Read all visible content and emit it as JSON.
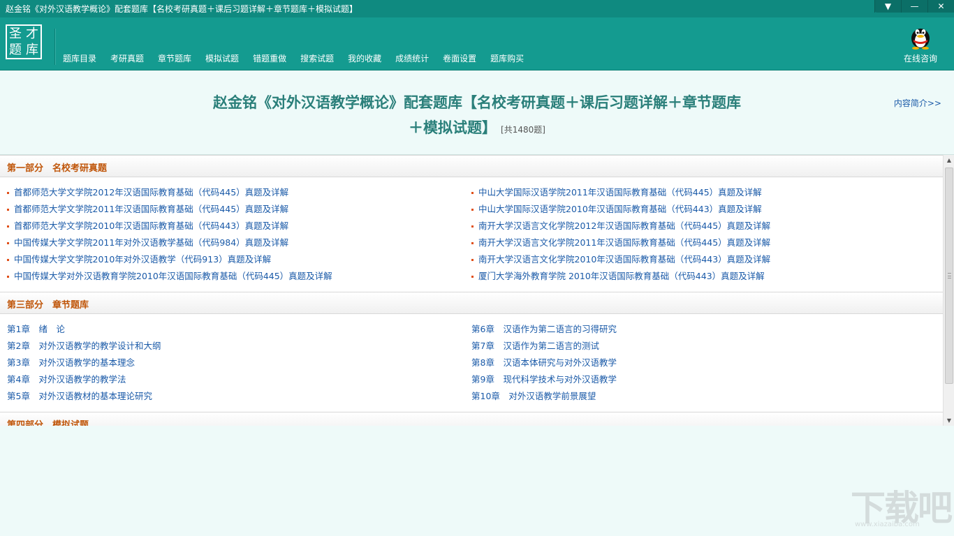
{
  "window": {
    "title": "赵金铭《对外汉语教学概论》配套题库【名校考研真题＋课后习题详解＋章节题库＋模拟试题】",
    "menu_glyph": "▼",
    "minimize_glyph": "—",
    "close_glyph": "✕"
  },
  "logo": {
    "chars": [
      "圣",
      "才",
      "题",
      "库"
    ]
  },
  "nav": [
    "题库目录",
    "考研真题",
    "章节题库",
    "模拟试题",
    "错题重做",
    "搜索试题",
    "我的收藏",
    "成绩统计",
    "卷面设置",
    "题库购买"
  ],
  "consult": {
    "label": "在线咨询"
  },
  "intro": {
    "title": "赵金铭《对外汉语教学概论》配套题库【名校考研真题＋课后习题详解＋章节题库＋模拟试题】",
    "count": "[共1480题]",
    "desc_link": "内容简介>>"
  },
  "sections": [
    {
      "title": "第一部分　名校考研真题",
      "left": [
        "首都师范大学文学院2012年汉语国际教育基础（代码445）真题及详解",
        "首都师范大学文学院2011年汉语国际教育基础（代码445）真题及详解",
        "首都师范大学文学院2010年汉语国际教育基础（代码443）真题及详解",
        "中国传媒大学文学院2011年对外汉语教学基础（代码984）真题及详解",
        "中国传媒大学文学院2010年对外汉语教学（代码913）真题及详解",
        "中国传媒大学对外汉语教育学院2010年汉语国际教育基础（代码445）真题及详解"
      ],
      "right": [
        "中山大学国际汉语学院2011年汉语国际教育基础（代码445）真题及详解",
        "中山大学国际汉语学院2010年汉语国际教育基础（代码443）真题及详解",
        "南开大学汉语言文化学院2012年汉语国际教育基础（代码445）真题及详解",
        "南开大学汉语言文化学院2011年汉语国际教育基础（代码445）真题及详解",
        "南开大学汉语言文化学院2010年汉语国际教育基础（代码443）真题及详解",
        "厦门大学海外教育学院 2010年汉语国际教育基础（代码443）真题及详解"
      ]
    },
    {
      "title": "第三部分　章节题库",
      "left": [
        "第1章　绪　论",
        "第2章　对外汉语教学的教学设计和大纲",
        "第3章　对外汉语教学的基本理念",
        "第4章　对外汉语教学的教学法",
        "第5章　对外汉语教材的基本理论研究"
      ],
      "right": [
        "第6章　汉语作为第二语言的习得研究",
        "第7章　汉语作为第二语言的测试",
        "第8章　汉语本体研究与对外汉语教学",
        "第9章　现代科学技术与对外汉语教学",
        "第10章　对外汉语教学前景展望"
      ]
    },
    {
      "title": "第四部分　模拟试题"
    }
  ],
  "scrollbar": {
    "up": "▲",
    "down": "▼"
  },
  "watermark": {
    "text": "下载吧",
    "url": "www.xiazaiba.com"
  },
  "colors": {
    "header": "#149b90",
    "titlebar": "#0f8a80",
    "section_title": "#c0560a",
    "link": "#1a5aa8",
    "bg": "#eefaf9"
  }
}
